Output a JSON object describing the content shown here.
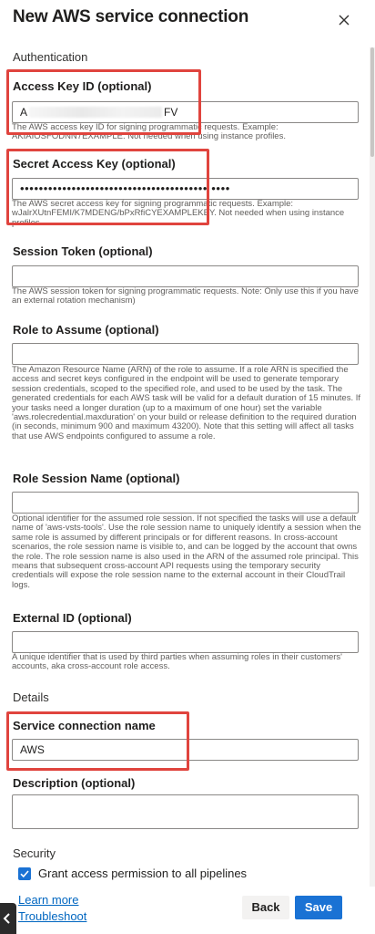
{
  "dialog": {
    "title": "New AWS service connection"
  },
  "sections": {
    "authentication": "Authentication",
    "details": "Details",
    "security": "Security"
  },
  "fields": {
    "access_key_id": {
      "label": "Access Key ID (optional)",
      "value_prefix": "A",
      "value_suffix": "FV",
      "help": "The AWS access key ID for signing programmatic requests. Example: AKIAIOSFODNN7EXAMPLE. Not needed when using instance profiles."
    },
    "secret_access_key": {
      "label": "Secret Access Key (optional)",
      "value_masked": "•••••••••••••••••••••••••••••••••••••••• ••••",
      "help": "The AWS secret access key for signing programmatic requests. Example: wJalrXUtnFEMI/K7MDENG/bPxRfiCYEXAMPLEKEY. Not needed when using instance profiles."
    },
    "session_token": {
      "label": "Session Token (optional)",
      "value": "",
      "help": "The AWS session token for signing programmatic requests. Note: Only use this if you have an external rotation mechanism)"
    },
    "role_to_assume": {
      "label": "Role to Assume (optional)",
      "value": "",
      "help": "The Amazon Resource Name (ARN) of the role to assume. If a role ARN is specified the access and secret keys configured in the endpoint will be used to generate temporary session credentials, scoped to the specified role, and used to be used by the task. The generated credentials for each AWS task will be valid for a default duration of 15 minutes. If your tasks need a longer duration (up to a maximum of one hour) set the variable 'aws.rolecredential.maxduration' on your build or release definition to the required duration (in seconds, minimum 900 and maximum 43200). Note that this setting will affect all tasks that use AWS endpoints configured to assume a role."
    },
    "role_session_name": {
      "label": "Role Session Name (optional)",
      "value": "",
      "help": "Optional identifier for the assumed role session. If not specified the tasks will use a default name of 'aws-vsts-tools'. Use the role session name to uniquely identify a session when the same role is assumed by different principals or for different reasons. In cross-account scenarios, the role session name is visible to, and can be logged by the account that owns the role. The role session name is also used in the ARN of the assumed role principal. This means that subsequent cross-account API requests using the temporary security credentials will expose the role session name to the external account in their CloudTrail logs."
    },
    "external_id": {
      "label": "External ID (optional)",
      "value": "",
      "help": "A unique identifier that is used by third parties when assuming roles in their customers' accounts, aka cross-account role access."
    },
    "service_connection_name": {
      "label": "Service connection name",
      "value": "AWS"
    },
    "description": {
      "label": "Description (optional)",
      "value": ""
    }
  },
  "security": {
    "grant_access_label": "Grant access permission to all pipelines",
    "grant_access_checked": true
  },
  "footer": {
    "learn_more": "Learn more",
    "troubleshoot": "Troubleshoot",
    "back_label": "Back",
    "save_label": "Save"
  },
  "colors": {
    "accent": "#1a72d4",
    "highlight": "#e0443e",
    "link": "#0066c0"
  }
}
